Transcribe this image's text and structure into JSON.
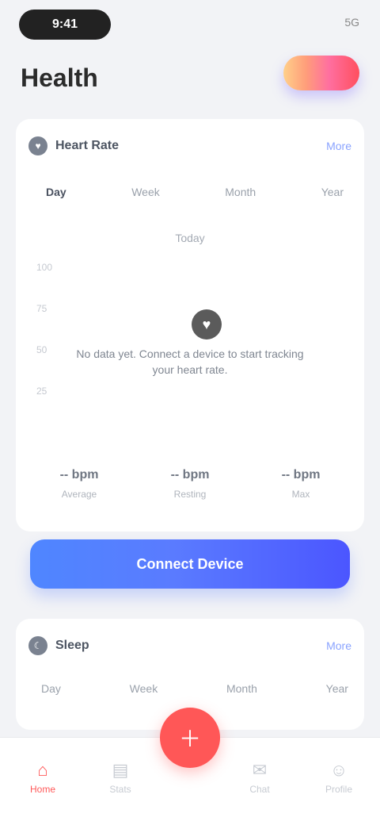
{
  "status": {
    "time": "9:41",
    "right": "5G"
  },
  "header": {
    "title": "Health"
  },
  "card1": {
    "title": "Heart Rate",
    "more": "More",
    "tabs": [
      "Day",
      "Week",
      "Month",
      "Year"
    ],
    "date": "Today",
    "axis": [
      "100",
      "75",
      "50",
      "25"
    ],
    "empty_icon": "heart-icon",
    "empty_text": "No data yet. Connect a device to start tracking your heart rate.",
    "stats": [
      {
        "value": "-- bpm",
        "label": "Average"
      },
      {
        "value": "-- bpm",
        "label": "Resting"
      },
      {
        "value": "-- bpm",
        "label": "Max"
      }
    ]
  },
  "cta": {
    "label": "Connect Device"
  },
  "card2": {
    "title": "Sleep",
    "more": "More",
    "tabs": [
      "Day",
      "Week",
      "Month",
      "Year"
    ]
  },
  "nav": {
    "items": [
      "Home",
      "Stats",
      "Add",
      "Chat",
      "Profile"
    ]
  },
  "colors": {
    "accent": "#ff5757",
    "cta": "#5a7bff"
  }
}
